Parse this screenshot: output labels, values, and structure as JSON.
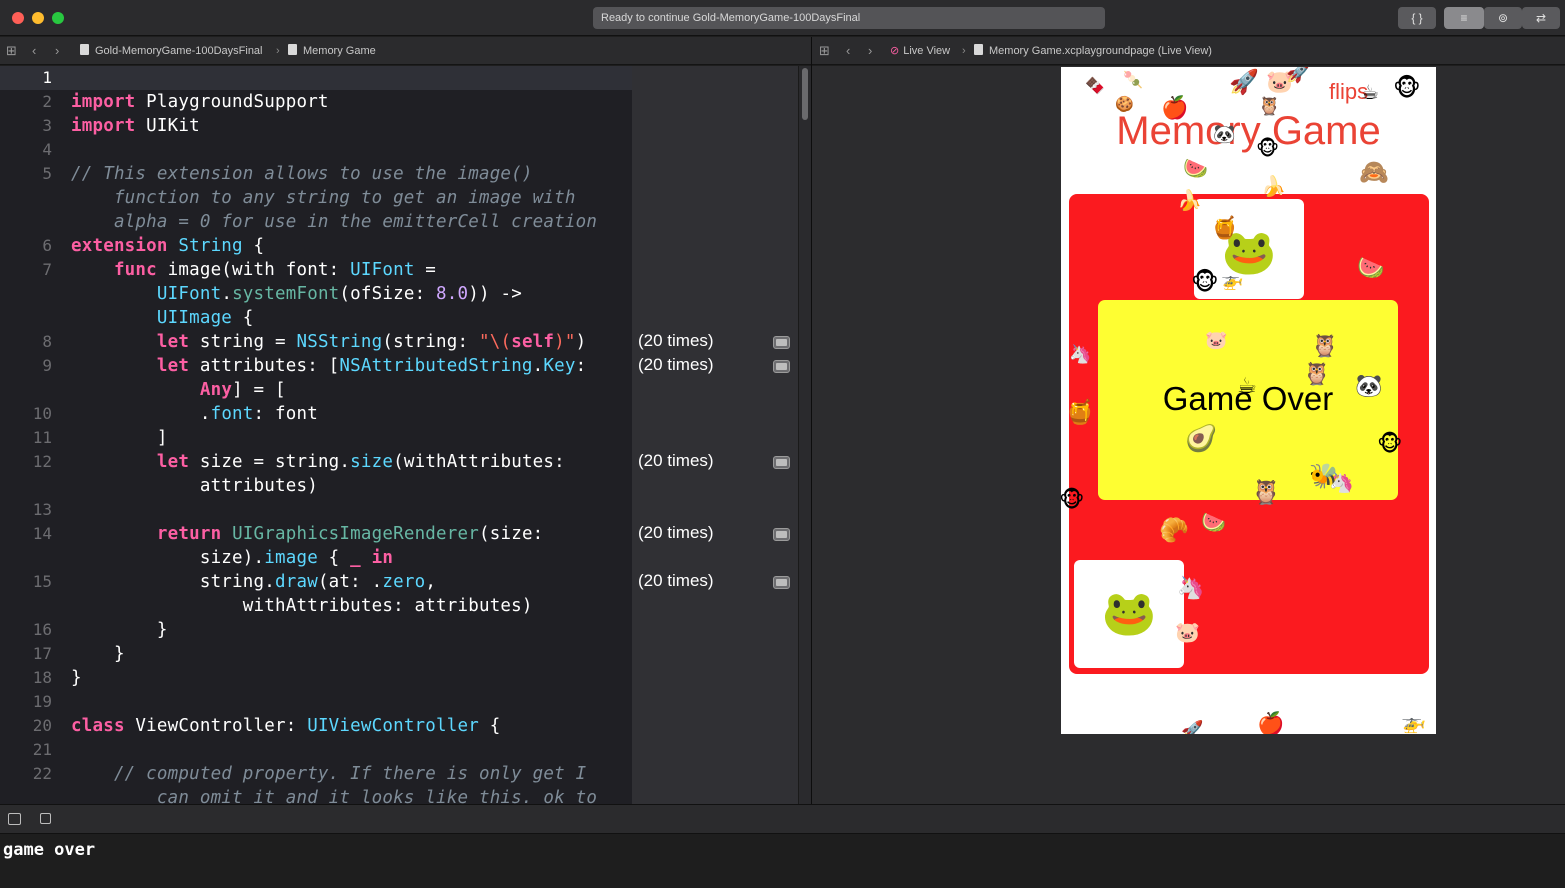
{
  "window": {
    "activity_text": "Ready to continue Gold-MemoryGame-100DaysFinal",
    "buttons": [
      "{ }",
      "≡",
      "⊚",
      "⇄"
    ]
  },
  "left_jumpbar": {
    "project": "Gold-MemoryGame-100DaysFinal",
    "page": "Memory Game"
  },
  "right_jumpbar": {
    "mode": "Live View",
    "page": "Memory Game.xcplaygroundpage (Live View)"
  },
  "editor": {
    "line_numbers": [
      "1",
      "2",
      "3",
      "4",
      "5",
      "6",
      "7",
      "8",
      "9",
      "10",
      "11",
      "12",
      "13",
      "14",
      "15",
      "16",
      "17",
      "18",
      "19",
      "20",
      "21",
      "22"
    ],
    "current_line": "1",
    "code": {
      "l2a": "import",
      "l2b": " PlaygroundSupport",
      "l3a": "import",
      "l3b": " UIKit",
      "l5": "// This extension allows to use the image()",
      "l5b": "    function to any string to get an image with",
      "l5c": "    alpha = 0 for use in the emitterCell creation",
      "l6a": "extension",
      "l6b": " String",
      "l6c": " {",
      "l7a": "    func",
      "l7b": " image(with font: ",
      "l7c": "UIFont",
      "l7d": " =",
      "l7e": "        ",
      "l7f": "UIFont",
      "l7g": ".",
      "l7h": "systemFont",
      "l7i": "(ofSize: ",
      "l7j": "8.0",
      "l7k": ")) ->",
      "l7l": "        ",
      "l7m": "UIImage",
      "l7n": " {",
      "l8a": "        let",
      "l8b": " string = ",
      "l8c": "NSString",
      "l8d": "(string: ",
      "l8e": "\"\\(",
      "l8f": "self",
      "l8g": ")\"",
      "l8h": ")",
      "l9a": "        let",
      "l9b": " attributes: [",
      "l9c": "NSAttributedString",
      "l9d": ".",
      "l9e": "Key",
      "l9f": ":",
      "l9g": "            ",
      "l9h": "Any",
      "l9i": "] = [",
      "l10a": "            .",
      "l10b": "font",
      "l10c": ": font",
      "l11": "        ]",
      "l12a": "        let",
      "l12b": " size = string.",
      "l12c": "size",
      "l12d": "(withAttributes:",
      "l12e": "            attributes)",
      "l14a": "        return",
      "l14b": " ",
      "l14c": "UIGraphicsImageRenderer",
      "l14d": "(size:",
      "l14e": "            size).",
      "l14f": "image",
      "l14g": " { ",
      "l14h": "_",
      "l14i": " ",
      "l14j": "in",
      "l15a": "            string.",
      "l15b": "draw",
      "l15c": "(at: .",
      "l15d": "zero",
      "l15e": ",",
      "l15f": "                withAttributes: attributes)",
      "l16": "        }",
      "l17": "    }",
      "l18": "}",
      "l20a": "class",
      "l20b": " ViewController: ",
      "l20c": "UIViewController",
      "l20d": " {",
      "l22": "    // computed property. If there is only get I",
      "l22b": "        can omit it and it looks like this. ok to"
    }
  },
  "results": {
    "r8": "(20 times)",
    "r9": "(20 times)",
    "r12": "(20 times)",
    "r14": "(20 times)",
    "r15": "(20 times)"
  },
  "live_view": {
    "title": "Memory Game",
    "flips_label": "flips",
    "card_top_emoji": "🐸",
    "card_bottom_emoji": "🐸",
    "game_over_text": "Game Over",
    "confetti": [
      "🍫",
      "🍡",
      "🍪",
      "🍎",
      "🚀",
      "🐷",
      "🚀",
      "🦉",
      "🐼",
      "🐵",
      "🍉",
      "🍌",
      "🙈",
      "🍌",
      "🍯",
      "🐵",
      "🚁",
      "🍉",
      "🐷",
      "🦉",
      "🦄",
      "🦉",
      "☕",
      "🐼",
      "🍯",
      "🥑",
      "🐵",
      "🐝",
      "🦄",
      "🦉",
      "🐵",
      "🥐",
      "🍉",
      "🦄",
      "🐷",
      "🚀",
      "🍎",
      "🚁",
      "☕",
      "🐵"
    ]
  },
  "console": {
    "output": "game over"
  }
}
